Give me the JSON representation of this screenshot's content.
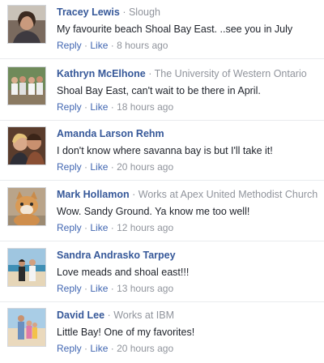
{
  "comments": [
    {
      "author": "Tracey Lewis",
      "affiliation": "Slough",
      "text": "My favourite beach Shoal Bay East. ..see you in July",
      "reply": "Reply",
      "like": "Like",
      "time": "8 hours ago",
      "avatar_icon": "profile-photo-woman"
    },
    {
      "author": "Kathryn McElhone",
      "affiliation": "The University of Western Ontario",
      "text": "Shoal Bay East, can't wait to be there in April.",
      "reply": "Reply",
      "like": "Like",
      "time": "18 hours ago",
      "avatar_icon": "profile-photo-group"
    },
    {
      "author": "Amanda Larson Rehm",
      "affiliation": "",
      "text": "I don't know where savanna bay is but I'll take it!",
      "reply": "Reply",
      "like": "Like",
      "time": "20 hours ago",
      "avatar_icon": "profile-photo-couple"
    },
    {
      "author": "Mark Hollamon",
      "affiliation": "Works at Apex United Methodist Church",
      "text": "Wow. Sandy Ground. Ya know me too well!",
      "reply": "Reply",
      "like": "Like",
      "time": "12 hours ago",
      "avatar_icon": "profile-photo-cat"
    },
    {
      "author": "Sandra Andrasko Tarpey",
      "affiliation": "",
      "text": "Love meads and shoal east!!!",
      "reply": "Reply",
      "like": "Like",
      "time": "13 hours ago",
      "avatar_icon": "profile-photo-beach-couple"
    },
    {
      "author": "David Lee",
      "affiliation": "Works at IBM",
      "text": "Little Bay! One of my favorites!",
      "reply": "Reply",
      "like": "Like",
      "time": "20 hours ago",
      "avatar_icon": "profile-photo-family"
    }
  ],
  "separator_glyph": "·",
  "colors": {
    "link": "#365899",
    "action_link": "#4267b2",
    "meta": "#90949c",
    "text": "#1d2129"
  }
}
